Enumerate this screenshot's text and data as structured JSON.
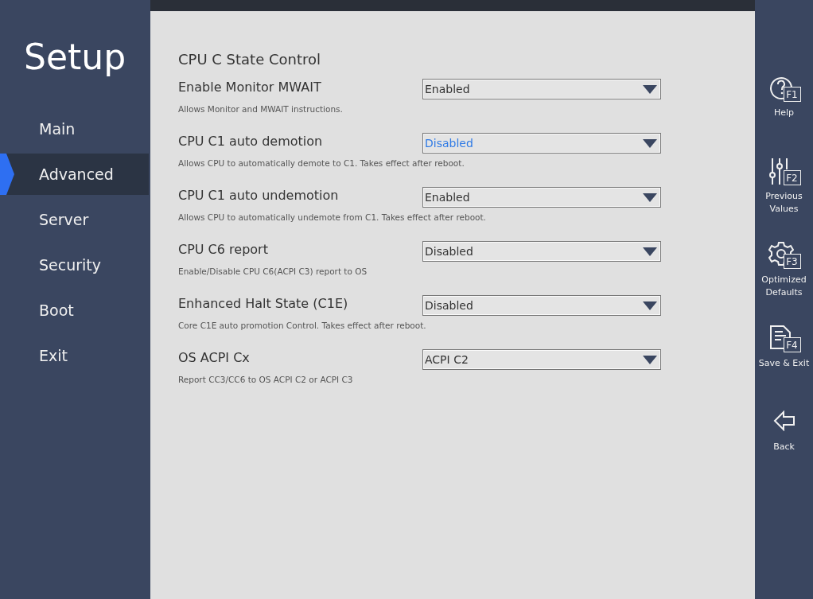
{
  "sidebar": {
    "title": "Setup",
    "items": [
      {
        "label": "Main",
        "selected": false
      },
      {
        "label": "Advanced",
        "selected": true
      },
      {
        "label": "Server",
        "selected": false
      },
      {
        "label": "Security",
        "selected": false
      },
      {
        "label": "Boot",
        "selected": false
      },
      {
        "label": "Exit",
        "selected": false
      }
    ]
  },
  "page": {
    "heading": "CPU C State Control",
    "settings": [
      {
        "label": "Enable Monitor MWAIT",
        "value": "Enabled",
        "description": "Allows Monitor and MWAIT instructions.",
        "focused": false
      },
      {
        "label": "CPU C1 auto demotion",
        "value": "Disabled",
        "description": "Allows CPU to automatically demote to C1. Takes effect after reboot.",
        "focused": true
      },
      {
        "label": "CPU C1 auto undemotion",
        "value": "Enabled",
        "description": "Allows CPU to automatically undemote from C1. Takes effect after reboot.",
        "focused": false
      },
      {
        "label": "CPU C6 report",
        "value": "Disabled",
        "description": "Enable/Disable CPU C6(ACPI C3) report to OS",
        "focused": false
      },
      {
        "label": "Enhanced Halt State (C1E)",
        "value": "Disabled",
        "description": "Core C1E auto promotion Control. Takes effect after reboot.",
        "focused": false
      },
      {
        "label": "OS ACPI Cx",
        "value": "ACPI C2",
        "description": "Report CC3/CC6 to OS ACPI C2 or ACPI C3",
        "focused": false
      }
    ]
  },
  "actions": [
    {
      "kind": "help",
      "key": "F1",
      "label": "Help"
    },
    {
      "kind": "previous",
      "key": "F2",
      "label": "Previous Values"
    },
    {
      "kind": "defaults",
      "key": "F3",
      "label": "Optimized Defaults"
    },
    {
      "kind": "save",
      "key": "F4",
      "label": "Save & Exit"
    },
    {
      "kind": "back",
      "label": "Back"
    }
  ]
}
